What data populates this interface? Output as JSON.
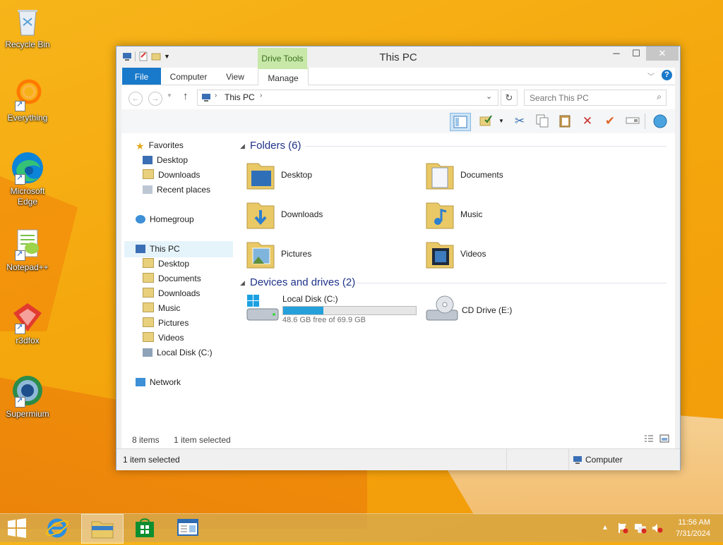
{
  "desktop_icons": [
    {
      "label": "Recycle Bin",
      "icon": "recycle-bin-icon"
    },
    {
      "label": "Everything",
      "icon": "everything-icon"
    },
    {
      "label": "Microsoft Edge",
      "icon": "edge-icon"
    },
    {
      "label": "Notepad++",
      "icon": "notepadpp-icon"
    },
    {
      "label": "r3dfox",
      "icon": "r3dfox-icon"
    },
    {
      "label": "Supermium",
      "icon": "supermium-icon"
    }
  ],
  "window": {
    "title": "This PC",
    "context_tab": "Drive Tools",
    "tabs": {
      "file": "File",
      "computer": "Computer",
      "view": "View",
      "manage": "Manage"
    },
    "address": {
      "location": "This PC"
    },
    "search": {
      "placeholder": "Search This PC"
    }
  },
  "nav": {
    "favorites": "Favorites",
    "desktop": "Desktop",
    "downloads": "Downloads",
    "recent": "Recent places",
    "homegroup": "Homegroup",
    "thispc": "This PC",
    "pc_items": [
      "Desktop",
      "Documents",
      "Downloads",
      "Music",
      "Pictures",
      "Videos",
      "Local Disk (C:)"
    ],
    "network": "Network"
  },
  "folders_group": "Folders (6)",
  "folders": [
    "Desktop",
    "Documents",
    "Downloads",
    "Music",
    "Pictures",
    "Videos"
  ],
  "devices_group": "Devices and drives (2)",
  "drives": {
    "c": {
      "label": "Local Disk (C:)",
      "free": "48.6 GB free of 69.9 GB",
      "used_fraction": 0.305
    },
    "e": {
      "label": "CD Drive (E:)"
    }
  },
  "status": {
    "items": "8 items",
    "selected": "1 item selected"
  },
  "details": {
    "selected": "1 item selected",
    "computer": "Computer"
  },
  "clock": {
    "time": "11:56 AM",
    "date": "7/31/2024"
  },
  "colors": {
    "accent": "#1979ca",
    "drive_tools": "#c7e8a8",
    "progress": "#26a0da"
  }
}
